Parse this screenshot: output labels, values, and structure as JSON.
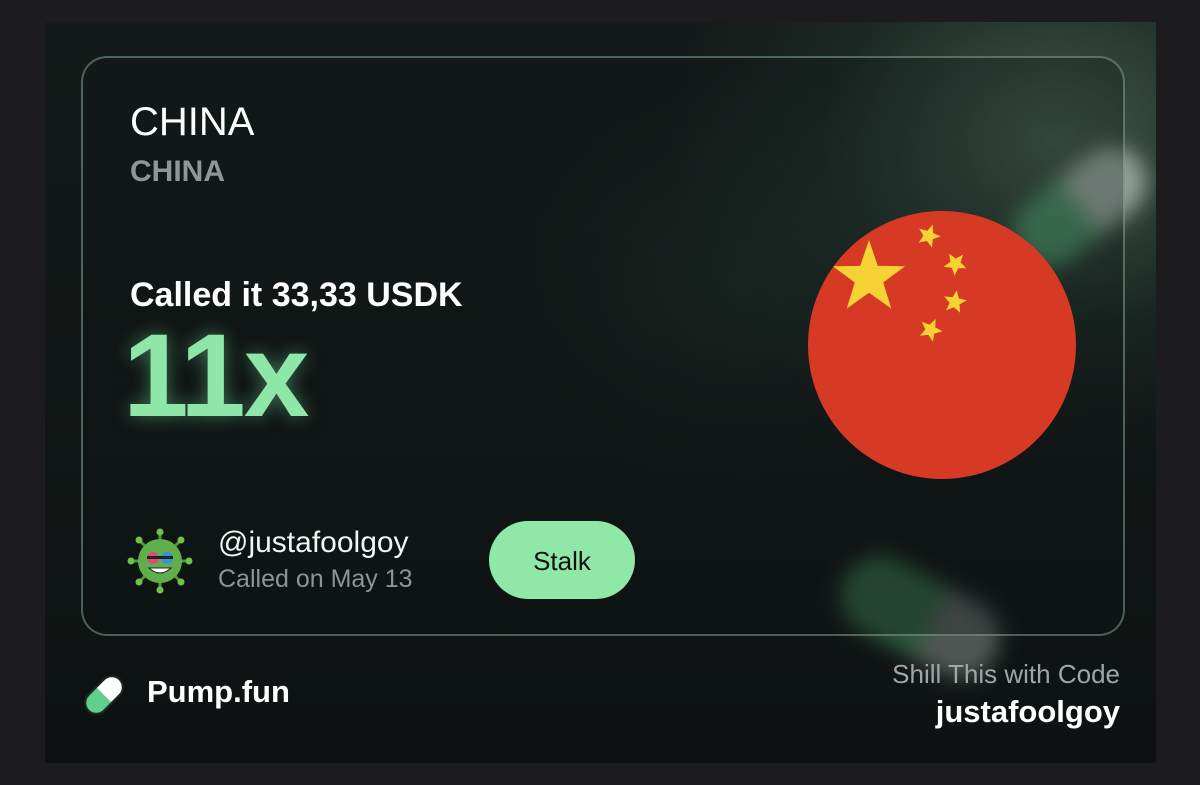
{
  "card": {
    "token_name": "CHINA",
    "token_ticker": "CHINA",
    "called_line": "Called it 33,33 USDK",
    "multiplier": "11x",
    "flag_icon": "china-flag-icon",
    "user": {
      "username": "@justafoolgoy",
      "called_date": "Called on May 13",
      "avatar_icon": "virus-avatar-icon"
    },
    "stalk_label": "Stalk"
  },
  "footer": {
    "brand_name": "Pump.fun",
    "brand_icon": "pill-icon",
    "shill_label": "Shill This with Code",
    "shill_code": "justafoolgoy"
  },
  "colors": {
    "accent_green": "#8fe7a8",
    "flag_red": "#d63a25",
    "flag_star": "#f7d234",
    "background": "#0f1313"
  }
}
